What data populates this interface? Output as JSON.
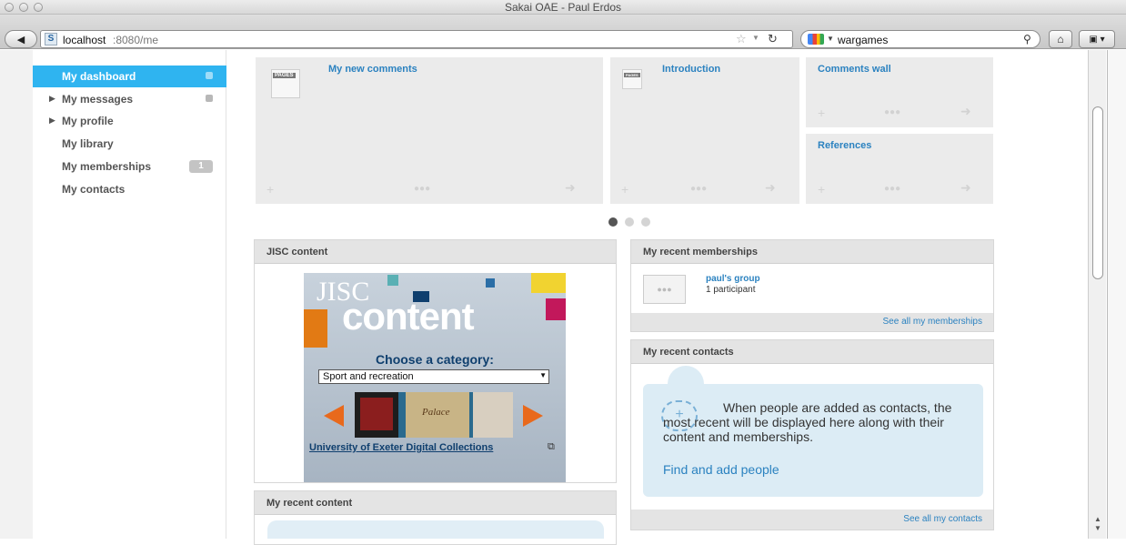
{
  "window": {
    "title": "Sakai OAE - Paul Erdos"
  },
  "browser": {
    "url_host": "localhost",
    "url_rest": ":8080/me",
    "favicon_letter": "S",
    "search_query": "wargames"
  },
  "sidebar": {
    "items": [
      {
        "label": "My dashboard"
      },
      {
        "label": "My messages"
      },
      {
        "label": "My profile"
      },
      {
        "label": "My library"
      },
      {
        "label": "My memberships",
        "badge": "1"
      },
      {
        "label": "My contacts"
      }
    ]
  },
  "carousel": {
    "cells": [
      {
        "title": "My new comments",
        "icon_label": "PAGES"
      },
      {
        "title": "Introduction",
        "icon_label": "PAGES"
      },
      {
        "title": "Comments wall"
      },
      {
        "title": "References"
      }
    ]
  },
  "jisc": {
    "header": "JISC content",
    "logo_top": "JISC",
    "logo_bottom": "content",
    "choose_label": "Choose a category:",
    "category_value": "Sport and recreation",
    "film_label": "Palace",
    "collection_link": "University of Exeter Digital Collections"
  },
  "memberships": {
    "header": "My recent memberships",
    "group_name": "paul's group",
    "participants": "1 participant",
    "footer_link": "See all my memberships"
  },
  "contacts": {
    "header": "My recent contacts",
    "message": "When people are added as contacts, the most recent will be displayed here along with their content and memberships.",
    "find_link": "Find and add people",
    "footer_link": "See all my contacts"
  },
  "recent_content": {
    "header": "My recent content"
  },
  "colors": {
    "accent": "#2fb4f0",
    "link": "#2b82c0",
    "arrow": "#e8691c"
  }
}
